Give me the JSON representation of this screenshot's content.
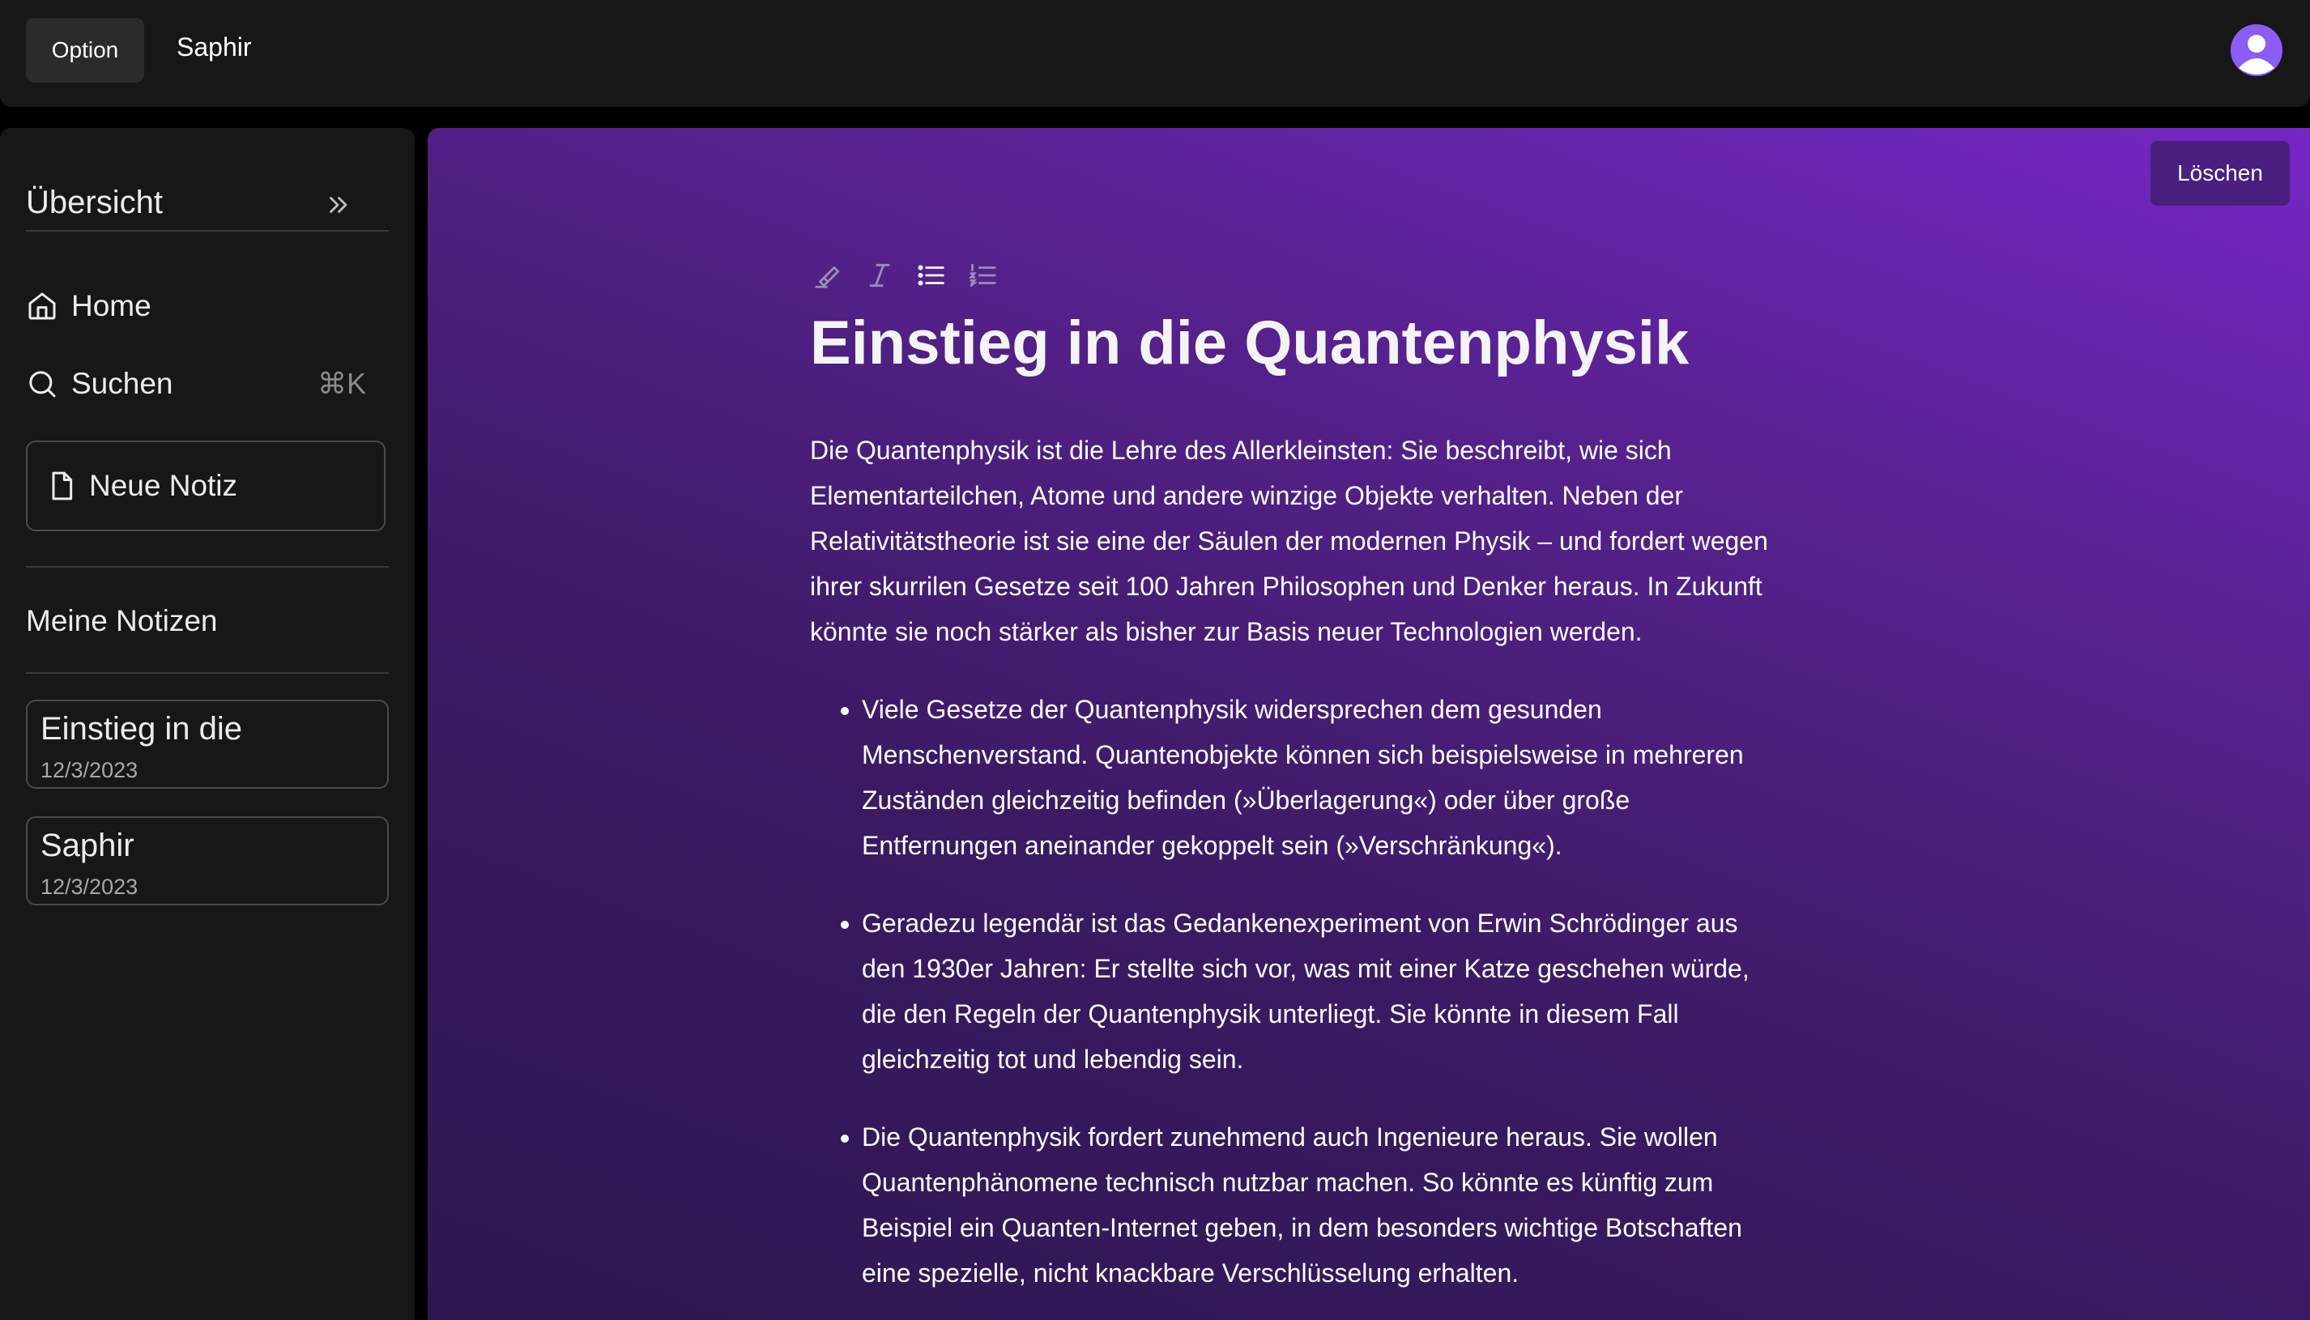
{
  "topbar": {
    "option_label": "Option",
    "app_title": "Saphir"
  },
  "sidebar": {
    "header_title": "Übersicht",
    "nav": {
      "home_label": "Home",
      "search_label": "Suchen",
      "search_shortcut": "⌘K"
    },
    "new_note_label": "Neue Notiz",
    "section_title": "Meine Notizen",
    "notes": [
      {
        "title": "Einstieg in die",
        "date": "12/3/2023"
      },
      {
        "title": "Saphir",
        "date": "12/3/2023"
      }
    ]
  },
  "main": {
    "delete_label": "Löschen",
    "title": "Einstieg in die Quantenphysik",
    "paragraph": "Die Quantenphysik ist die Lehre des Allerkleinsten: Sie beschreibt, wie sich Elementarteilchen, Atome und andere winzige Objekte verhalten. Neben der Relativitätstheorie ist sie eine der Säulen der modernen Physik – und fordert wegen ihrer skurrilen Gesetze seit 100 Jahren Philosophen und Denker heraus. In Zukunft könnte sie noch stärker als bisher zur Basis neuer Technologien werden.",
    "bullets": [
      "Viele Gesetze der Quantenphysik widersprechen dem gesunden Menschenverstand. Quantenobjekte können sich beispielsweise in mehreren Zuständen gleichzeitig befinden (»Überlagerung«) oder über große Entfernungen aneinander gekoppelt sein (»Verschränkung«).",
      "Geradezu legendär ist das Gedankenexperiment von Erwin Schrödinger aus den 1930er Jahren: Er stellte sich vor, was mit einer Katze geschehen würde, die den Regeln der Quantenphysik unterliegt. Sie könnte in diesem Fall gleichzeitig tot und lebendig sein.",
      "Die Quantenphysik fordert zunehmend auch Ingenieure heraus. Sie wollen Quantenphänomene technisch nutzbar machen. So könnte es künftig zum Beispiel ein Quanten-Internet geben, in dem besonders wichtige Botschaften eine spezielle, nicht knackbare Verschlüsselung erhalten."
    ]
  },
  "icons": {
    "toolbar": [
      "highlighter-icon",
      "italic-icon",
      "bullet-list-icon",
      "numbered-list-icon"
    ]
  },
  "colors": {
    "accent": "#8b5cf6",
    "delete_button": "#4a1f80",
    "panel": "#171717"
  }
}
